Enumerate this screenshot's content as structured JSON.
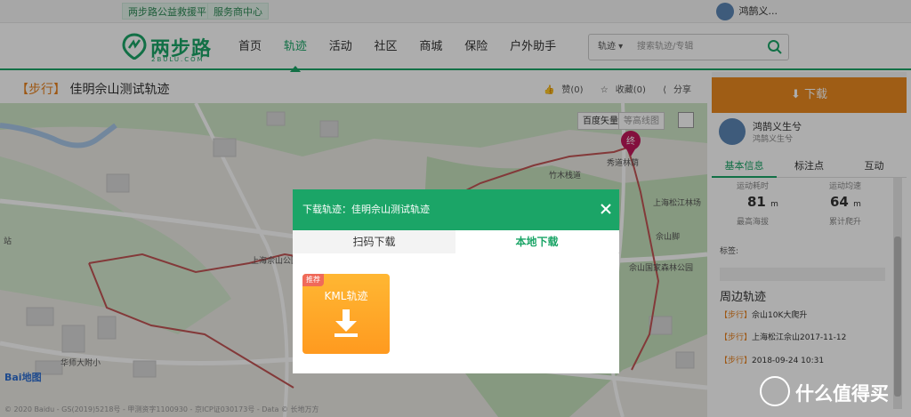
{
  "topbar": {
    "links": [
      "两步路公益救援平台",
      "服务商中心"
    ],
    "user_name": "鸿鹄义..."
  },
  "header": {
    "logo_name": "两步路",
    "logo_sub": "2BULU.COM",
    "nav": [
      "首页",
      "轨迹",
      "活动",
      "社区",
      "商城",
      "保险",
      "户外助手"
    ],
    "active_nav": "轨迹",
    "search": {
      "type": "轨迹",
      "placeholder": "搜索轨迹/专辑"
    }
  },
  "track": {
    "tag": "【步行】",
    "title": "佳明佘山测试轨迹",
    "like": "赞(0)",
    "collect": "收藏(0)",
    "share": "分享"
  },
  "map": {
    "mode_vector": "百度矢量",
    "mode_contour": "等高线图",
    "end_marker": "终",
    "labels": [
      "竹木栈道",
      "秀道林荫",
      "上海松江林场",
      "佘山脚",
      "上海佘山公园",
      "佘山国家森林公园",
      "华师大附小",
      "站"
    ],
    "copyright": "© 2020 Baidu - GS(2019)5218号 - 甲测资字1100930 - 京ICP证030173号 - Data © 长地万方",
    "baidu_logo": "Bai地图"
  },
  "modal": {
    "title": "下载轨迹：佳明佘山测试轨迹",
    "tabs": [
      "扫码下载",
      "本地下载"
    ],
    "active_tab": "本地下载",
    "badge": "推荐",
    "file_label": "KML轨迹"
  },
  "sidebar": {
    "download_label": "下载",
    "user_name": "鸿鹄义生兮",
    "user_sub": "鸿鹄义生兮",
    "tabs": [
      "基本信息",
      "标注点",
      "互动"
    ],
    "active_tab": "基本信息",
    "stats": {
      "duration_label": "运动耗时",
      "speed_label": "运动均速",
      "max_alt_value": "81",
      "max_alt_unit": "m",
      "max_alt_label": "最高海拔",
      "climb_value": "64",
      "climb_unit": "m",
      "climb_label": "累计爬升"
    },
    "tags_label": "标签:",
    "nearby_title": "周边轨迹",
    "nearby": [
      {
        "type": "【步行】",
        "name": "佘山10K大爬升"
      },
      {
        "type": "【步行】",
        "name": "上海松江佘山2017-11-12"
      },
      {
        "type": "【步行】",
        "name": "2018-09-24 10:31"
      }
    ]
  },
  "watermark": "什么值得买",
  "colors": {
    "brand": "#1ba567",
    "accent": "#ea8a1f"
  }
}
